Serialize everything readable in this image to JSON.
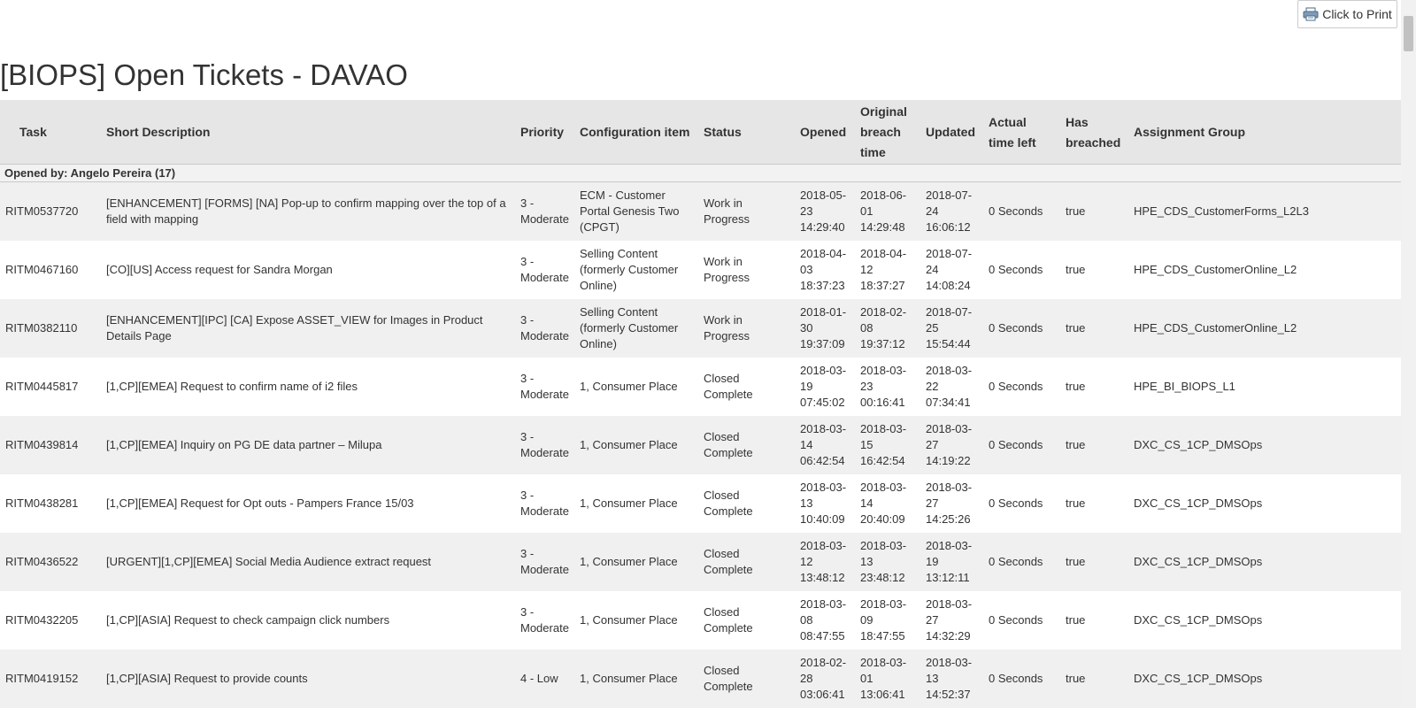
{
  "toolbar": {
    "print_label": "Click to Print",
    "print_icon": "printer-icon"
  },
  "title": "[BIOPS] Open Tickets - DAVAO",
  "columns": [
    {
      "label": "Task"
    },
    {
      "label": "Short Description"
    },
    {
      "label": "Priority"
    },
    {
      "label": "Configuration item"
    },
    {
      "label": "Status"
    },
    {
      "label": "Opened"
    },
    {
      "label": "Original breach time"
    },
    {
      "label": "Updated"
    },
    {
      "label": "Actual time left"
    },
    {
      "label": "Has breached"
    },
    {
      "label": "Assignment Group"
    }
  ],
  "group": {
    "label": "Opened by: Angelo Pereira (17)"
  },
  "rows": [
    {
      "task": "RITM0537720",
      "desc": "[ENHANCEMENT] [FORMS] [NA] Pop-up to confirm mapping over the top of a field with mapping",
      "priority": "3 - Moderate",
      "ci": "ECM - Customer Portal Genesis Two (CPGT)",
      "status": "Work in Progress",
      "opened": "2018-05-23 14:29:40",
      "breach": "2018-06-01 14:29:48",
      "updated": "2018-07-24 16:06:12",
      "left": "0 Seconds",
      "breached": "true",
      "group": "HPE_CDS_CustomerForms_L2L3"
    },
    {
      "task": "RITM0467160",
      "desc": "[CO][US] Access request for Sandra Morgan",
      "priority": "3 - Moderate",
      "ci": "Selling Content (formerly Customer Online)",
      "status": "Work in Progress",
      "opened": "2018-04-03 18:37:23",
      "breach": "2018-04-12 18:37:27",
      "updated": "2018-07-24 14:08:24",
      "left": "0 Seconds",
      "breached": "true",
      "group": "HPE_CDS_CustomerOnline_L2"
    },
    {
      "task": "RITM0382110",
      "desc": "[ENHANCEMENT][IPC] [CA] Expose ASSET_VIEW for Images in Product Details Page",
      "priority": "3 - Moderate",
      "ci": "Selling Content (formerly Customer Online)",
      "status": "Work in Progress",
      "opened": "2018-01-30 19:37:09",
      "breach": "2018-02-08 19:37:12",
      "updated": "2018-07-25 15:54:44",
      "left": "0 Seconds",
      "breached": "true",
      "group": "HPE_CDS_CustomerOnline_L2"
    },
    {
      "task": "RITM0445817",
      "desc": "[1,CP][EMEA] Request to confirm name of i2 files",
      "priority": "3 - Moderate",
      "ci": "1, Consumer Place",
      "status": "Closed Complete",
      "opened": "2018-03-19 07:45:02",
      "breach": "2018-03-23 00:16:41",
      "updated": "2018-03-22 07:34:41",
      "left": "0 Seconds",
      "breached": "true",
      "group": "HPE_BI_BIOPS_L1"
    },
    {
      "task": "RITM0439814",
      "desc": "[1,CP][EMEA] Inquiry on PG DE data partner – Milupa",
      "priority": "3 - Moderate",
      "ci": "1, Consumer Place",
      "status": "Closed Complete",
      "opened": "2018-03-14 06:42:54",
      "breach": "2018-03-15 16:42:54",
      "updated": "2018-03-27 14:19:22",
      "left": "0 Seconds",
      "breached": "true",
      "group": "DXC_CS_1CP_DMSOps"
    },
    {
      "task": "RITM0438281",
      "desc": "[1,CP][EMEA] Request for Opt outs - Pampers France 15/03",
      "priority": "3 - Moderate",
      "ci": "1, Consumer Place",
      "status": "Closed Complete",
      "opened": "2018-03-13 10:40:09",
      "breach": "2018-03-14 20:40:09",
      "updated": "2018-03-27 14:25:26",
      "left": "0 Seconds",
      "breached": "true",
      "group": "DXC_CS_1CP_DMSOps"
    },
    {
      "task": "RITM0436522",
      "desc": "[URGENT][1,CP][EMEA] Social Media Audience extract request",
      "priority": "3 - Moderate",
      "ci": "1, Consumer Place",
      "status": "Closed Complete",
      "opened": "2018-03-12 13:48:12",
      "breach": "2018-03-13 23:48:12",
      "updated": "2018-03-19 13:12:11",
      "left": "0 Seconds",
      "breached": "true",
      "group": "DXC_CS_1CP_DMSOps"
    },
    {
      "task": "RITM0432205",
      "desc": "[1,CP][ASIA] Request to check campaign click numbers",
      "priority": "3 - Moderate",
      "ci": "1, Consumer Place",
      "status": "Closed Complete",
      "opened": "2018-03-08 08:47:55",
      "breach": "2018-03-09 18:47:55",
      "updated": "2018-03-27 14:32:29",
      "left": "0 Seconds",
      "breached": "true",
      "group": "DXC_CS_1CP_DMSOps"
    },
    {
      "task": "RITM0419152",
      "desc": "[1,CP][ASIA] Request to provide counts",
      "priority": "4 - Low",
      "ci": "1, Consumer Place",
      "status": "Closed Complete",
      "opened": "2018-02-28 03:06:41",
      "breach": "2018-03-01 13:06:41",
      "updated": "2018-03-13 14:52:37",
      "left": "0 Seconds",
      "breached": "true",
      "group": "DXC_CS_1CP_DMSOps"
    }
  ]
}
